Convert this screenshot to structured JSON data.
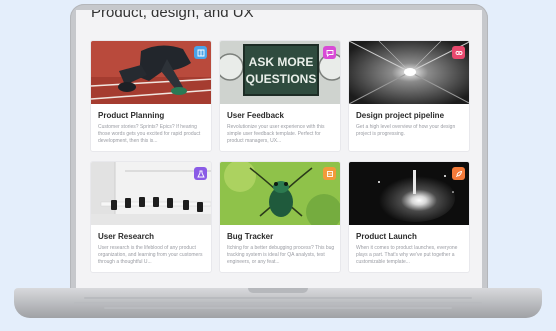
{
  "page": {
    "title": "Product, design, and UX"
  },
  "cards": [
    {
      "title": "Product Planning",
      "description": "Customer stories? Sprints? Epics? If hearing those words gets you excited for rapid product development, then this is...",
      "badge_icon": "book-icon",
      "badge_color": "#4aa3e8"
    },
    {
      "title": "User Feedback",
      "description": "Revolutionize your user experience with this simple user feedback template. Perfect for product managers, UX...",
      "badge_icon": "chat-icon",
      "badge_color": "#d84bd6"
    },
    {
      "title": "Design project pipeline",
      "description": "Get a high level overview of how your design project is progressing.",
      "badge_icon": "pipeline-icon",
      "badge_color": "#e8496e"
    },
    {
      "title": "User Research",
      "description": "User research is the lifeblood of any product organization, and learning from your customers through a thoughtful U...",
      "badge_icon": "flask-icon",
      "badge_color": "#8a5be6"
    },
    {
      "title": "Bug Tracker",
      "description": "Itching for a better debugging process? This bug tracking system is ideal for QA analysts, test engineers, or any feat...",
      "badge_icon": "bug-icon",
      "badge_color": "#f29a3a"
    },
    {
      "title": "Product Launch",
      "description": "When it comes to product launches, everyone plays a part. That's why we've put together a customizable template...",
      "badge_icon": "rocket-icon",
      "badge_color": "#f47a3a"
    }
  ],
  "sign_text": [
    "ASK MORE",
    "QUESTIONS"
  ]
}
